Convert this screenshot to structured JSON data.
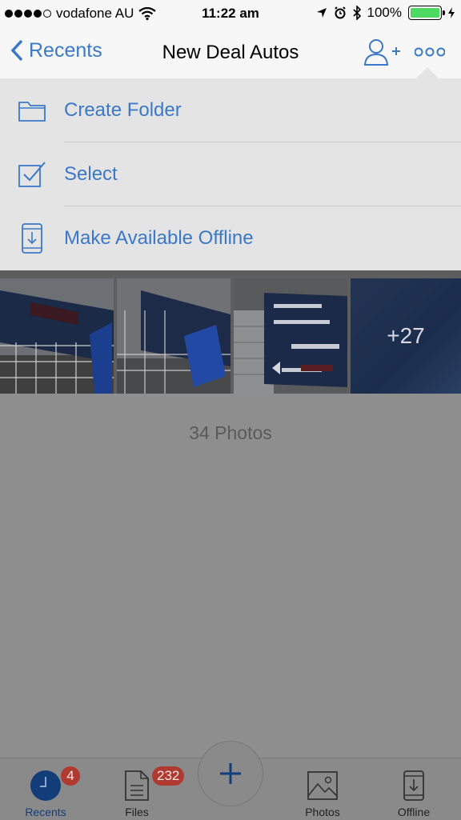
{
  "status_bar": {
    "carrier": "vodafone AU",
    "time": "11:22 am",
    "battery_percent": "100%",
    "battery_level": 1.0,
    "signal_bars": 4,
    "signal_max": 5
  },
  "nav": {
    "back_label": "Recents",
    "title": "New Deal Autos",
    "icons": [
      "add-person-icon",
      "more-icon",
      "chevron-left-icon"
    ]
  },
  "menu": {
    "items": [
      {
        "label": "Create Folder",
        "icon": "folder-icon"
      },
      {
        "label": "Select",
        "icon": "checkbox-icon"
      },
      {
        "label": "Make Available Offline",
        "icon": "offline-phone-icon"
      }
    ]
  },
  "gallery": {
    "more_count": "+27",
    "photo_count_label": "34 Photos"
  },
  "tab_bar": {
    "items": [
      {
        "label": "Recents",
        "badge": "4",
        "icon": "clock-icon",
        "active": true
      },
      {
        "label": "Files",
        "badge": "232",
        "icon": "file-icon",
        "active": false
      },
      {
        "label": "Photos",
        "icon": "photo-icon",
        "active": false
      },
      {
        "label": "Offline",
        "icon": "offline-phone-icon",
        "active": false
      }
    ],
    "add_icon": "plus-icon"
  },
  "colors": {
    "accent": "#3b78c9",
    "dim_overlay": "#8e8e8e",
    "badge": "#b03a30",
    "battery": "#4cd964",
    "active_tab": "#123d79"
  }
}
